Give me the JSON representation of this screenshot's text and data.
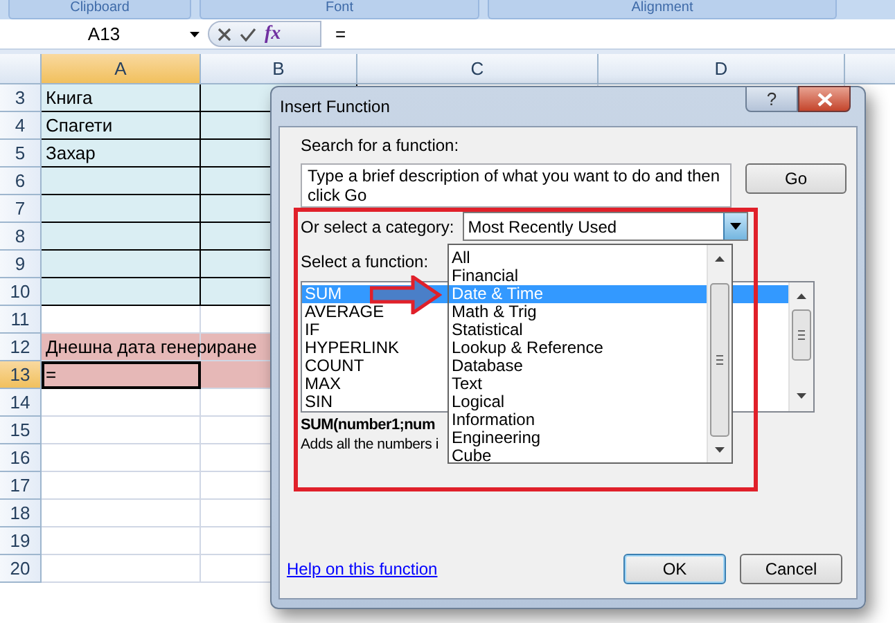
{
  "ribbon_groups": [
    {
      "label": "Clipboard"
    },
    {
      "label": "Font"
    },
    {
      "label": "Alignment"
    }
  ],
  "formula_bar": {
    "name_box": "A13",
    "fx": "fx",
    "formula": "="
  },
  "columns": [
    {
      "label": "A",
      "selected": true
    },
    {
      "label": "B",
      "selected": false
    },
    {
      "label": "C",
      "selected": false
    },
    {
      "label": "D",
      "selected": false
    }
  ],
  "rows": [
    {
      "number": "3",
      "selected": false,
      "kind": "table",
      "text": "Книга"
    },
    {
      "number": "4",
      "selected": false,
      "kind": "table",
      "text": "Спагети"
    },
    {
      "number": "5",
      "selected": false,
      "kind": "table",
      "text": "Захар"
    },
    {
      "number": "6",
      "selected": false,
      "kind": "table"
    },
    {
      "number": "7",
      "selected": false,
      "kind": "table"
    },
    {
      "number": "8",
      "selected": false,
      "kind": "table"
    },
    {
      "number": "9",
      "selected": false,
      "kind": "table"
    },
    {
      "number": "10",
      "selected": false,
      "kind": "table"
    },
    {
      "number": "11",
      "selected": false,
      "kind": "plain"
    },
    {
      "number": "12",
      "selected": false,
      "kind": "highlight",
      "text": "Днешна дата генериране"
    },
    {
      "number": "13",
      "selected": true,
      "kind": "highlight",
      "text": "="
    },
    {
      "number": "14",
      "selected": false,
      "kind": "plain"
    },
    {
      "number": "15",
      "selected": false,
      "kind": "plain"
    },
    {
      "number": "16",
      "selected": false,
      "kind": "plain"
    },
    {
      "number": "17",
      "selected": false,
      "kind": "plain"
    },
    {
      "number": "18",
      "selected": false,
      "kind": "plain"
    },
    {
      "number": "19",
      "selected": false,
      "kind": "plain"
    },
    {
      "number": "20",
      "selected": false,
      "kind": "plain"
    }
  ],
  "dialog": {
    "title": "Insert Function",
    "help_button": "?",
    "search_label": "Search for a function:",
    "search_value": "Type a brief description of what you want to do and then click Go",
    "go_button": "Go",
    "category_label": "Or select a category:",
    "category_value": "Most Recently Used",
    "category_options": [
      {
        "label": "All",
        "selected": false
      },
      {
        "label": "Financial",
        "selected": false
      },
      {
        "label": "Date & Time",
        "selected": true
      },
      {
        "label": "Math & Trig",
        "selected": false
      },
      {
        "label": "Statistical",
        "selected": false
      },
      {
        "label": "Lookup & Reference",
        "selected": false
      },
      {
        "label": "Database",
        "selected": false
      },
      {
        "label": "Text",
        "selected": false
      },
      {
        "label": "Logical",
        "selected": false
      },
      {
        "label": "Information",
        "selected": false
      },
      {
        "label": "Engineering",
        "selected": false
      },
      {
        "label": "Cube",
        "selected": false
      }
    ],
    "function_label": "Select a function:",
    "functions": [
      {
        "label": "SUM",
        "selected": true
      },
      {
        "label": "AVERAGE",
        "selected": false
      },
      {
        "label": "IF",
        "selected": false
      },
      {
        "label": "HYPERLINK",
        "selected": false
      },
      {
        "label": "COUNT",
        "selected": false
      },
      {
        "label": "MAX",
        "selected": false
      },
      {
        "label": "SIN",
        "selected": false
      }
    ],
    "signature": "SUM(number1;num",
    "description": "Adds all the numbers i",
    "help_link": "Help on this function",
    "buttons": [
      {
        "label": "OK",
        "default": true
      },
      {
        "label": "Cancel",
        "default": false
      }
    ]
  }
}
